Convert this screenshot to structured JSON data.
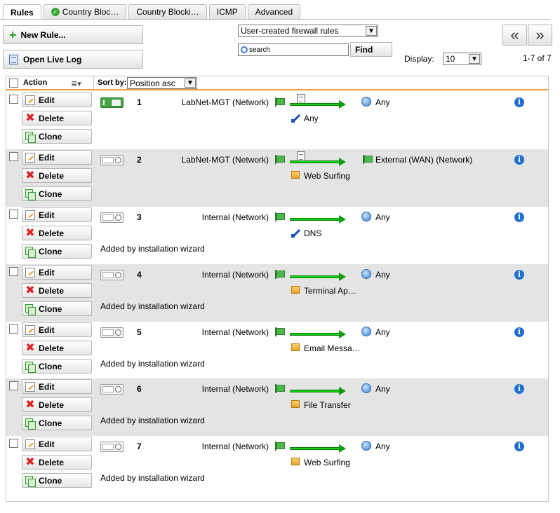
{
  "tabs": [
    {
      "label": "Rules",
      "active": true
    },
    {
      "label": "Country Bloc…",
      "icon": "check-circle-icon"
    },
    {
      "label": "Country Blocki…"
    },
    {
      "label": "ICMP"
    },
    {
      "label": "Advanced"
    }
  ],
  "toolbar": {
    "new_rule": "New Rule...",
    "open_live_log": "Open Live Log",
    "filter_select": "User-created firewall rules",
    "search_placeholder": "search",
    "find": "Find",
    "display_label": "Display:",
    "display_value": "10",
    "range": "1-7 of 7",
    "first_page": "«",
    "next_page": "»"
  },
  "table_header": {
    "action": "Action",
    "sort_by_label": "Sort by:",
    "sort_by_value": "Position asc",
    "list_icon": "≣▾"
  },
  "row_buttons": {
    "edit": "Edit",
    "delete": "Delete",
    "clone": "Clone"
  },
  "rows": [
    {
      "position": "1",
      "enabled": true,
      "source": "LabNet-MGT (Network)",
      "destination": "Any",
      "dest_icon": "globe-icon",
      "service": "Any",
      "service_icon": "wire-icon",
      "has_doc": true,
      "comment": ""
    },
    {
      "position": "2",
      "enabled": false,
      "source": "LabNet-MGT (Network)",
      "destination": "External (WAN) (Network)",
      "dest_icon": "network-flag-icon",
      "service": "Web Surfing",
      "service_icon": "service-group-icon",
      "has_doc": true,
      "comment": ""
    },
    {
      "position": "3",
      "enabled": false,
      "source": "Internal (Network)",
      "destination": "Any",
      "dest_icon": "globe-icon",
      "service": "DNS",
      "service_icon": "wire-icon",
      "has_doc": false,
      "comment": "Added by installation wizard"
    },
    {
      "position": "4",
      "enabled": false,
      "source": "Internal (Network)",
      "destination": "Any",
      "dest_icon": "globe-icon",
      "service": "Terminal Ap…",
      "service_icon": "service-group-icon",
      "has_doc": false,
      "comment": "Added by installation wizard"
    },
    {
      "position": "5",
      "enabled": false,
      "source": "Internal (Network)",
      "destination": "Any",
      "dest_icon": "globe-icon",
      "service": "Email Messa…",
      "service_icon": "service-group-icon",
      "has_doc": false,
      "comment": "Added by installation wizard"
    },
    {
      "position": "6",
      "enabled": false,
      "source": "Internal (Network)",
      "destination": "Any",
      "dest_icon": "globe-icon",
      "service": "File Transfer",
      "service_icon": "service-group-icon",
      "has_doc": false,
      "comment": "Added by installation wizard"
    },
    {
      "position": "7",
      "enabled": false,
      "source": "Internal (Network)",
      "destination": "Any",
      "dest_icon": "globe-icon",
      "service": "Web Surfing",
      "service_icon": "service-group-icon",
      "has_doc": false,
      "comment": "Added by installation wizard"
    }
  ],
  "colors": {
    "accent_orange": "#f09a3a",
    "arrow_green": "#19d019",
    "row_alt": "#e4e4e4",
    "info_blue": "#1f6fd1"
  }
}
